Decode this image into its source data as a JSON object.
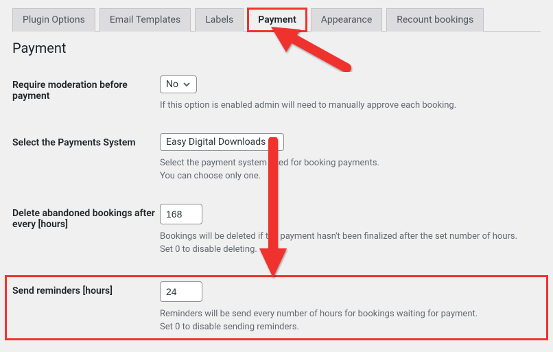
{
  "tabs": {
    "plugin_options": "Plugin Options",
    "email_templates": "Email Templates",
    "labels": "Labels",
    "payment": "Payment",
    "appearance": "Appearance",
    "recount_bookings": "Recount bookings"
  },
  "section_title": "Payment",
  "rows": {
    "moderation": {
      "label": "Require moderation before payment",
      "value": "No",
      "desc": "If this option is enabled admin will need to manually approve each booking."
    },
    "system": {
      "label": "Select the Payments System",
      "value": "Easy Digital Downloads",
      "desc1": "Select the payment system used for booking payments.",
      "desc2": "You can choose only one."
    },
    "abandoned": {
      "label": "Delete abandoned bookings after every [hours]",
      "value": "168",
      "desc1": "Bookings will be deleted if the payment hasn't been finalized after the set number of hours.",
      "desc2": "Set 0 to disable deleting."
    },
    "reminders": {
      "label": "Send reminders [hours]",
      "value": "24",
      "desc1": "Reminders will be send every number of hours for bookings waiting for payment.",
      "desc2": "Set 0 to disable sending reminders."
    }
  }
}
